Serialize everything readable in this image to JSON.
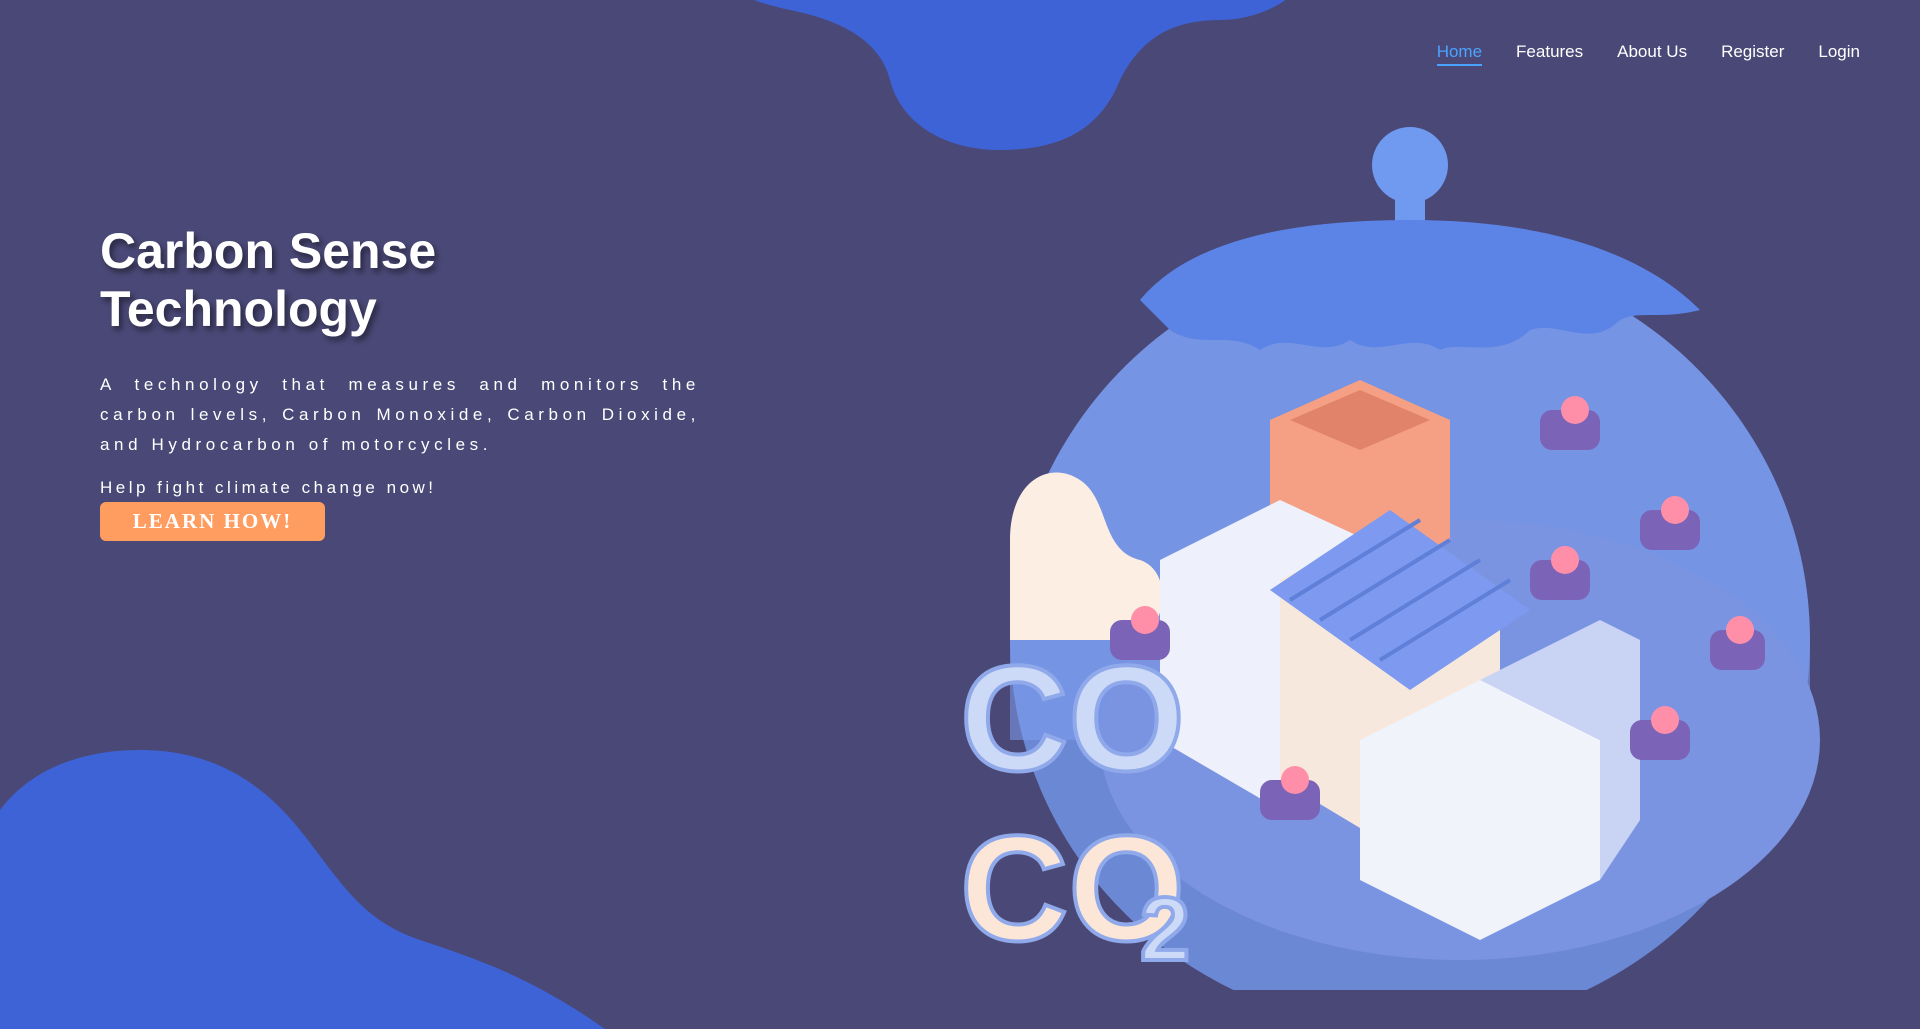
{
  "nav": {
    "items": [
      {
        "label": "Home",
        "active": true
      },
      {
        "label": "Features",
        "active": false
      },
      {
        "label": "About Us",
        "active": false
      },
      {
        "label": "Register",
        "active": false
      },
      {
        "label": "Login",
        "active": false
      }
    ]
  },
  "hero": {
    "title": "Carbon Sense Technology",
    "description": "A technology that measures and monitors the carbon levels, Carbon Monoxide, Carbon Dioxide, and Hydrocarbon of motorcycles.",
    "tagline": "Help fight climate change now!",
    "cta_label": "LEARN HOW!"
  },
  "colors": {
    "background": "#4a4876",
    "accent": "#4aa3ff",
    "cta": "#ff9d61",
    "blob": "#3d63d6"
  },
  "illustration": {
    "icon": "factory-dome-illustration",
    "label_co": "CO",
    "label_co2": "CO2"
  }
}
